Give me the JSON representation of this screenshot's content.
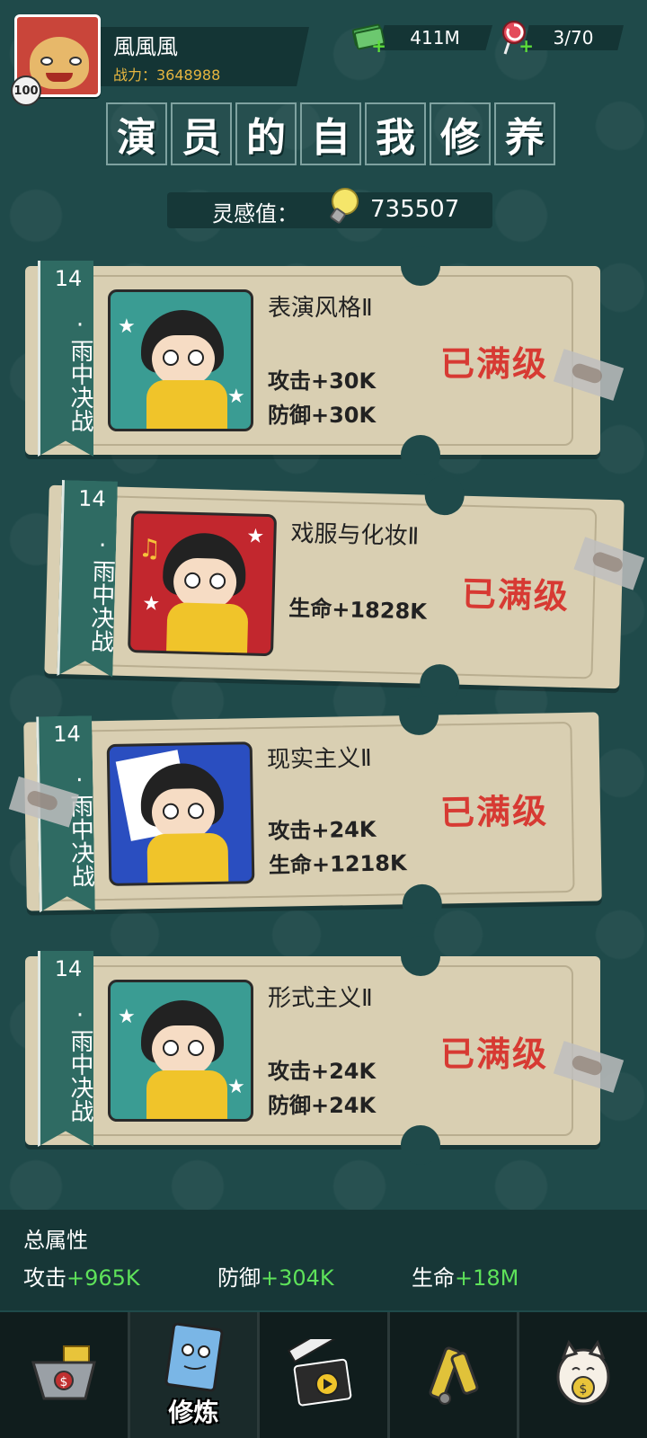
{
  "header": {
    "player_name": "風風風",
    "power_label": "战力：3648988",
    "level": "100",
    "money": "411M",
    "candy": "3/70"
  },
  "title_chars": [
    "演",
    "员",
    "的",
    "自",
    "我",
    "修",
    "养"
  ],
  "inspiration": {
    "label": "灵感值：",
    "value": "735507"
  },
  "cards": [
    {
      "chapter": "14",
      "stage": "·雨中决战",
      "skill": "表演风格Ⅱ",
      "stats": [
        "攻击+30K",
        "防御+30K"
      ],
      "status": "已满级",
      "portrait_bg": "#3a9c93"
    },
    {
      "chapter": "14",
      "stage": "·雨中决战",
      "skill": "戏服与化妆Ⅱ",
      "stats": [
        "生命+1828K"
      ],
      "status": "已满级",
      "portrait_bg": "#c2272e"
    },
    {
      "chapter": "14",
      "stage": "·雨中决战",
      "skill": "现实主义Ⅱ",
      "stats": [
        "攻击+24K",
        "生命+1218K"
      ],
      "status": "已满级",
      "portrait_bg": "#2a4ec0"
    },
    {
      "chapter": "14",
      "stage": "·雨中决战",
      "skill": "形式主义Ⅱ",
      "stats": [
        "攻击+24K",
        "防御+24K"
      ],
      "status": "已满级",
      "portrait_bg": "#3a9c93"
    }
  ],
  "summary": {
    "title": "总属性",
    "attack_label": "攻击",
    "attack_value": "+965K",
    "defense_label": "防御",
    "defense_value": "+304K",
    "life_label": "生命",
    "life_value": "+18M"
  },
  "nav": {
    "active_label": "修炼",
    "icons": [
      "shop-cart-icon",
      "notebook-icon",
      "clapperboard-icon",
      "telescope-icon",
      "lucky-cat-icon"
    ]
  }
}
